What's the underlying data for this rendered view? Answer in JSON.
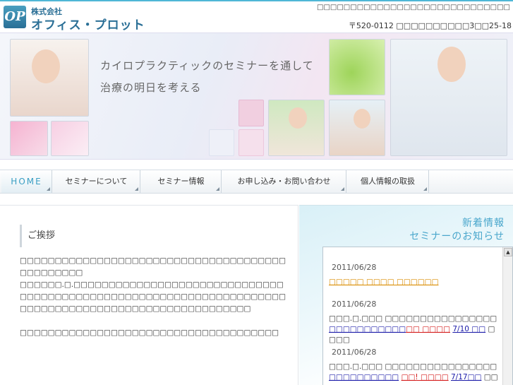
{
  "header": {
    "logo_mark": "OP",
    "logo_small": "株式会社",
    "logo_big": "オフィス・プロット",
    "tagline": "□□□□□□□□□□□□□□□□□□□□□□□□□□□□□",
    "address": "〒520-0112 □□□□□□□□□□3□□25-18"
  },
  "banner": {
    "line1": "カイロプラクティックのセミナーを通して",
    "line2": "治療の明日を考える"
  },
  "nav": {
    "items": [
      "HOME",
      "セミナーについて",
      "セミナー情報",
      "お申し込み・お問い合わせ",
      "個人情報の取扱"
    ]
  },
  "main": {
    "heading": "ご挨拶",
    "para1": "□□□□□□□□□□□□□□□□□□□□□□□□□□□□□□□□□□□□□□□□□□□□□□□",
    "para2": "□□□□□□.□.□□□□□□□□□□□□□□□□□□□□□□□□□□□□□□□□□□□□□□□□□□□□□□□□□□□□□□□□□□□□□□□□□□□□□□□□□□□□□□□□□□□□□□□□□□□□□□□□□□□□□",
    "para3": "□□□□□□□□□□□□□□□□□□□□□□□□□□□□□□□□□□□□□"
  },
  "sidebar": {
    "title1": "新着情報",
    "title2": "セミナーのお知らせ",
    "scroll_up": "▲",
    "news": [
      {
        "date": "2011/06/28",
        "link_orange": "□□□□□ □□□□ □□□□□□"
      },
      {
        "date": "2011/06/28",
        "text_pre": "□□□.□.□□□ □□□□□□□□□□□□□□□□",
        "link_blue": "□□□□□□□□□□□",
        "link_red": "□□ □□□□",
        "link_blue2": "7/10 □□",
        "text_post": " □□□□"
      },
      {
        "date": "2011/06/28",
        "text_pre": "□□□.□.□□□ □□□□□□□□□□□□□□□□",
        "link_blue": "□□□□□□□□□□",
        "link_red": "□□! □□□□",
        "link_blue2": "7/17□□",
        "text_post": " □□□□"
      }
    ]
  }
}
